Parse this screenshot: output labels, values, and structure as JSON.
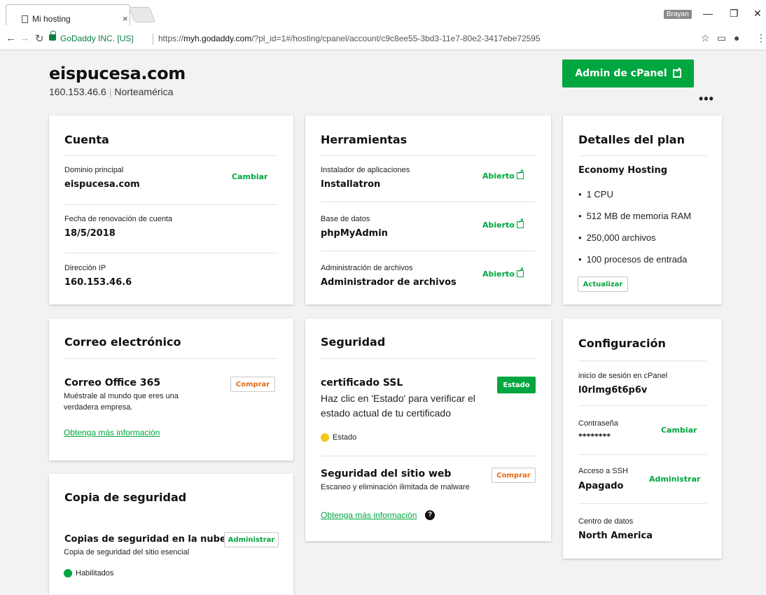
{
  "browser": {
    "tab_title": "Mi hosting",
    "tab_close": "×",
    "user_badge": "Brayan",
    "ev_label": "GoDaddy INC. [US]",
    "url_prefix": "https://",
    "url_host": "myh.godaddy.com",
    "url_path": "/?pl_id=1#/hosting/cpanel/account/c9c8ee55-3bd3-11e7-80e2-3417ebe72595"
  },
  "header": {
    "domain": "eispucesa.com",
    "ip": "160.153.46.6",
    "region": "Norteamérica",
    "cpanel_button": "Admin de cPanel",
    "more": "•••"
  },
  "cuenta": {
    "title": "Cuenta",
    "rows": [
      {
        "label": "Dominio principal",
        "value": "eispucesa.com",
        "action": "Cambiar"
      },
      {
        "label": "Fecha de renovación de cuenta",
        "value": "18/5/2018"
      },
      {
        "label": "Dirección IP",
        "value": "160.153.46.6"
      }
    ]
  },
  "herramientas": {
    "title": "Herramientas",
    "rows": [
      {
        "label": "Instalador de aplicaciones",
        "value": "Installatron",
        "action": "Abierto"
      },
      {
        "label": "Base de datos",
        "value": "phpMyAdmin",
        "action": "Abierto"
      },
      {
        "label": "Administración de archivos",
        "value": "Administrador de archivos",
        "action": "Abierto"
      }
    ]
  },
  "plan": {
    "title": "Detalles del plan",
    "name": "Economy Hosting",
    "features": [
      "1 CPU",
      "512 MB de memoria RAM",
      "250,000 archivos",
      "100 procesos de entrada"
    ],
    "upgrade": "Actualizar"
  },
  "correo": {
    "title": "Correo electrónico",
    "product": "Correo Office 365",
    "desc_line1": "Muéstrale al mundo que eres una",
    "desc_line2": "verdadera empresa.",
    "buy": "Comprar",
    "more_info": "Obtenga más información"
  },
  "seguridad": {
    "title": "Seguridad",
    "ssl_title": "certificado SSL",
    "ssl_desc_line1": "Haz clic en 'Estado' para verificar el",
    "ssl_desc_line2": "estado actual de tu certificado",
    "status_button": "Estado",
    "status_text": "Estado",
    "status_color": "#f5c518",
    "web_title": "Seguridad del sitio web",
    "web_desc": "Escaneo y eliminación ilimitada de malware",
    "buy": "Comprar",
    "more_info": "Obtenga más información",
    "help_icon": "?"
  },
  "configuracion": {
    "title": "Configuración",
    "rows": [
      {
        "label": "inicio de sesión en cPanel",
        "value": "l0rlmg6t6p6v"
      },
      {
        "label": "Contraseña",
        "value": "********",
        "action": "Cambiar"
      },
      {
        "label": "Acceso a SSH",
        "value": "Apagado",
        "action": "Administrar"
      },
      {
        "label": "Centro de datos",
        "value": "North America"
      }
    ]
  },
  "copia": {
    "title": "Copia de seguridad",
    "product": "Copias de seguridad en la nube",
    "desc": "Copia de seguridad del sitio esencial",
    "manage": "Administrar",
    "status": "Habilitados",
    "status_color": "#00a63f"
  },
  "colors": {
    "brand_green": "#00a63f",
    "accent_orange": "#e56a10"
  }
}
